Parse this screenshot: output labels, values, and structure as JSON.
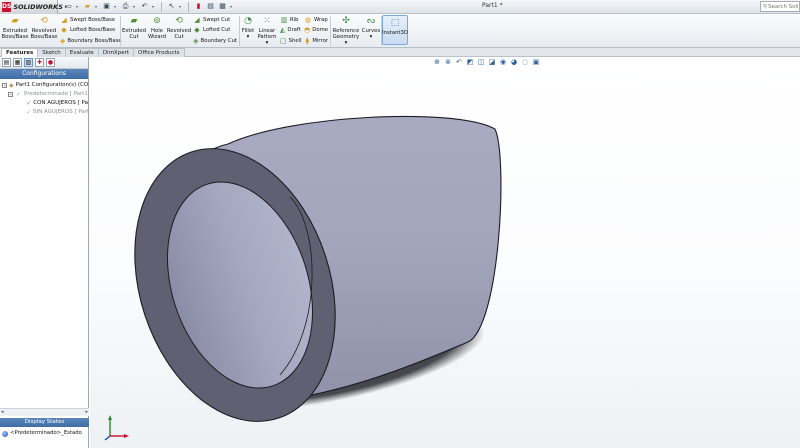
{
  "app": {
    "brand": "SOLIDWORKS",
    "document_title": "Part1 *",
    "search_placeholder": "Search Soli"
  },
  "ribbon": {
    "extruded_boss": "Extruded Boss/Base",
    "revolved_boss": "Revolved Boss/Base",
    "swept_boss": "Swept Boss/Base",
    "lofted_boss": "Lofted Boss/Base",
    "boundary_boss": "Boundary Boss/Base",
    "extruded_cut": "Extruded Cut",
    "hole_wizard": "Hole Wizard",
    "revolved_cut": "Revolved Cut",
    "swept_cut": "Swept Cut",
    "lofted_cut": "Lofted Cut",
    "boundary_cut": "Boundary Cut",
    "fillet": "Fillet",
    "linear_pattern": "Linear Pattern",
    "rib": "Rib",
    "draft": "Draft",
    "shell": "Shell",
    "wrap": "Wrap",
    "dome": "Dome",
    "mirror": "Mirror",
    "reference_geometry": "Reference Geometry",
    "curves": "Curves",
    "instant3d": "Instant3D"
  },
  "tabs": [
    {
      "label": "Features",
      "active": true
    },
    {
      "label": "Sketch",
      "active": false
    },
    {
      "label": "Evaluate",
      "active": false
    },
    {
      "label": "DimXpert",
      "active": false
    },
    {
      "label": "Office Products",
      "active": false
    }
  ],
  "panel": {
    "header": "Configurations",
    "tree": {
      "root": "Part1 Configuration(s)  (CO",
      "default_config": "Predeterminado [ Part1",
      "config_con": "CON AGUJEROS [ Pa",
      "config_sin": "SIN AGUJEROS [ Part"
    },
    "display_states_header": "Display States",
    "display_state_item": "<Predeterminado>_Estado"
  },
  "colors": {
    "panel_header": "#4a78b0",
    "model_face": "#a7a9bf",
    "model_dark": "#606272",
    "accent_red": "#c8102e"
  }
}
